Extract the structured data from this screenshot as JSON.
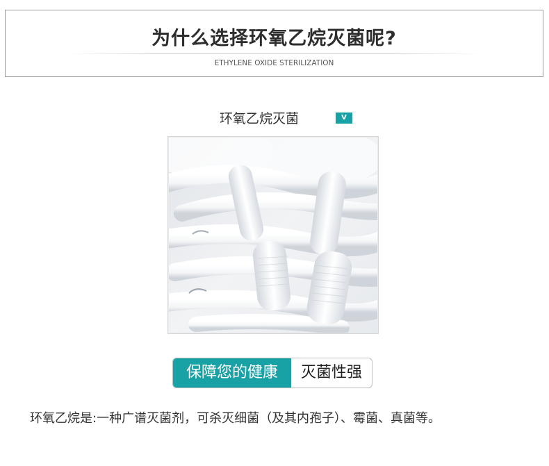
{
  "header": {
    "title": "为什么选择环氧乙烷灭菌呢?",
    "subtitle": "ETHYLENE OXIDE STERILIZATION"
  },
  "section": {
    "title": "环氧乙烷灭菌",
    "badge": "V"
  },
  "image": {
    "icon": "fabric-macro-image"
  },
  "tag": {
    "highlight": "保障您的健康",
    "text": "灭菌性强"
  },
  "description": "环氧乙烷是:一种广谱灭菌剂，可杀灭细菌（及其内孢子）、霉菌、真菌等。",
  "colors": {
    "accent": "#19a2a5"
  }
}
